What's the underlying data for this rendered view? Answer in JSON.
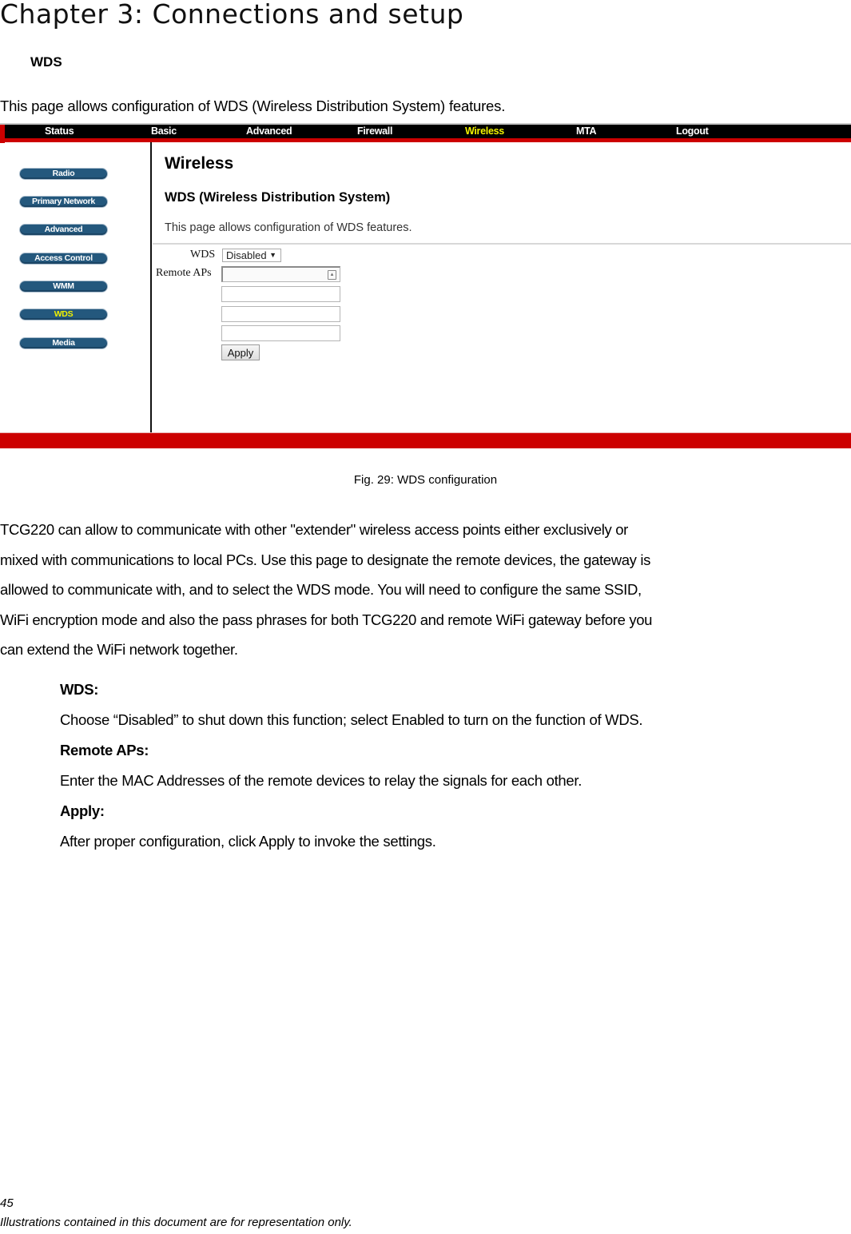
{
  "document": {
    "chapter_title": "Chapter 3: Connections and setup",
    "section_heading": "WDS",
    "intro": "This page allows configuration of WDS (Wireless Distribution System) features.",
    "figure_caption": "Fig. 29: WDS configuration",
    "body_lines": [
      "TCG220 can allow to communicate with other \"extender\" wireless access points either exclusively or",
      "mixed with communications to local PCs. Use this page to designate the remote devices, the gateway is",
      "allowed to communicate with, and to select the WDS mode. You will need to configure the same SSID,",
      "WiFi encryption mode and also the pass phrases for both TCG220 and remote WiFi gateway before you",
      "can extend the WiFi network together."
    ],
    "definitions": [
      {
        "term": "WDS:",
        "desc": "Choose “Disabled” to shut down this function; select Enabled to turn on the function of WDS."
      },
      {
        "term": "Remote APs:",
        "desc": "Enter the MAC Addresses of the remote devices to relay the signals for each other."
      },
      {
        "term": "Apply:",
        "desc": "After proper configuration, click Apply to invoke the settings."
      }
    ],
    "page_number": "45",
    "footer_note": "Illustrations contained in this document are for representation only."
  },
  "screenshot": {
    "top_nav": [
      {
        "label": "Status",
        "active": false
      },
      {
        "label": "Basic",
        "active": false
      },
      {
        "label": "Advanced",
        "active": false
      },
      {
        "label": "Firewall",
        "active": false
      },
      {
        "label": "Wireless",
        "active": true
      },
      {
        "label": "MTA",
        "active": false
      },
      {
        "label": "Logout",
        "active": false
      }
    ],
    "sidebar": [
      {
        "label": "Radio",
        "active": false
      },
      {
        "label": "Primary Network",
        "active": false
      },
      {
        "label": "Advanced",
        "active": false
      },
      {
        "label": "Access Control",
        "active": false
      },
      {
        "label": "WMM",
        "active": false
      },
      {
        "label": "WDS",
        "active": true
      },
      {
        "label": "Media",
        "active": false
      }
    ],
    "panel": {
      "title": "Wireless",
      "subtitle": "WDS (Wireless Distribution System)",
      "description": "This page allows configuration of WDS features."
    },
    "form": {
      "wds_label": "WDS",
      "wds_value": "Disabled",
      "remote_aps_label": "Remote APs",
      "remote_aps_values": [
        "",
        "",
        "",
        ""
      ],
      "apply_label": "Apply"
    },
    "colors": {
      "nav_bg": "#000000",
      "accent_red": "#cc0000",
      "active_text": "#f2f200",
      "sidebar_button": "#24587d"
    }
  }
}
